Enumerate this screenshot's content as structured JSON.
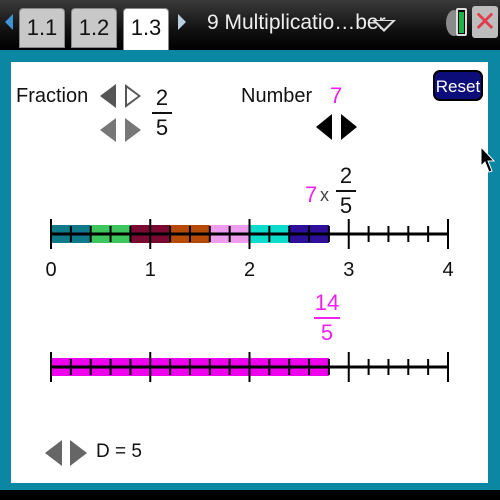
{
  "topbar": {
    "tabs": [
      {
        "label": "1.1",
        "active": false
      },
      {
        "label": "1.2",
        "active": false
      },
      {
        "label": "1.3",
        "active": true
      }
    ],
    "document_title": "9 Multiplicatio…ber",
    "icons": [
      "nav-left-arrow-icon",
      "nav-right-arrow-icon",
      "dropdown-icon",
      "settings-gear-icon",
      "battery-icon",
      "close-icon"
    ]
  },
  "controls": {
    "fraction_label": "Fraction",
    "fraction_numerator": "2",
    "fraction_denominator": "5",
    "number_label": "Number",
    "number_value": "7",
    "reset_label": "Reset",
    "denominator_label": "D = 5"
  },
  "expression": {
    "multiplier": "7",
    "times": "x",
    "numerator": "2",
    "denominator": "5"
  },
  "result": {
    "numerator": "14",
    "denominator": "5"
  },
  "colors": {
    "frame": "#0b86a3",
    "accent_magenta": "#ee22ee",
    "reset_button": "#0d0d7a",
    "segments": [
      "#0e7a8a",
      "#3ec65e",
      "#7a0a32",
      "#b84a08",
      "#ee9cee",
      "#0cdccc",
      "#2e0f9a"
    ],
    "result_bar": "#ee00ee"
  },
  "chart_data": {
    "type": "number-line",
    "min": 0,
    "max": 4,
    "subdivisions_per_unit": 5,
    "tick_labels": [
      "0",
      "1",
      "2",
      "3",
      "4"
    ],
    "top_line": {
      "segment_length": 0.4,
      "segment_count": 7,
      "end_value": 2.8
    },
    "bottom_line": {
      "bar_start": 0,
      "bar_end": 2.8
    }
  }
}
